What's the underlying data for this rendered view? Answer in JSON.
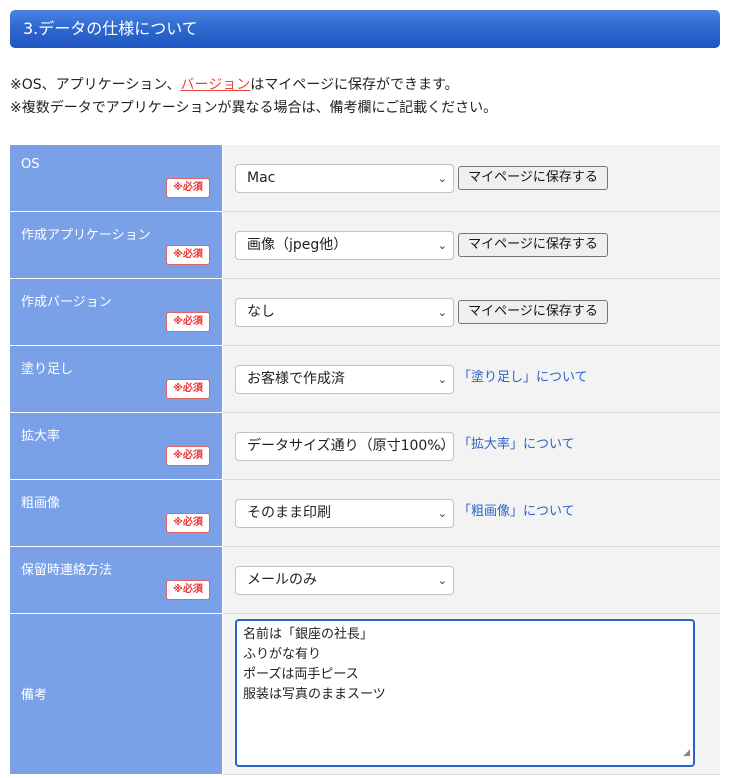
{
  "section": {
    "title": "3.データの仕様について"
  },
  "notes": {
    "line1_prefix": "※OS、アプリケーション、",
    "line1_link": "バージョン",
    "line1_suffix": "はマイページに保存ができます。",
    "line2": "※複数データでアプリケーションが異なる場合は、備考欄にご記載ください。"
  },
  "required_label": "※必須",
  "save_label": "マイページに保存する",
  "rows": [
    {
      "label": "OS",
      "value": "Mac"
    },
    {
      "label": "作成アプリケーション",
      "value": "画像（jpeg他）"
    },
    {
      "label": "作成バージョン",
      "value": "なし"
    },
    {
      "label": "塗り足し",
      "value": "お客様で作成済",
      "link": "「塗り足し」について"
    },
    {
      "label": "拡大率",
      "value": "データサイズ通り（原寸100%）",
      "link": "「拡大率」について"
    },
    {
      "label": "粗画像",
      "value": "そのまま印刷",
      "link": "「粗画像」について"
    },
    {
      "label": "保留時連絡方法",
      "value": "メールのみ"
    }
  ],
  "remarks": {
    "label": "備考",
    "lines": [
      "名前は「銀座の社長」",
      "ふりがな有り",
      "ポーズは両手ピース",
      "服装は写真のままスーツ"
    ]
  }
}
